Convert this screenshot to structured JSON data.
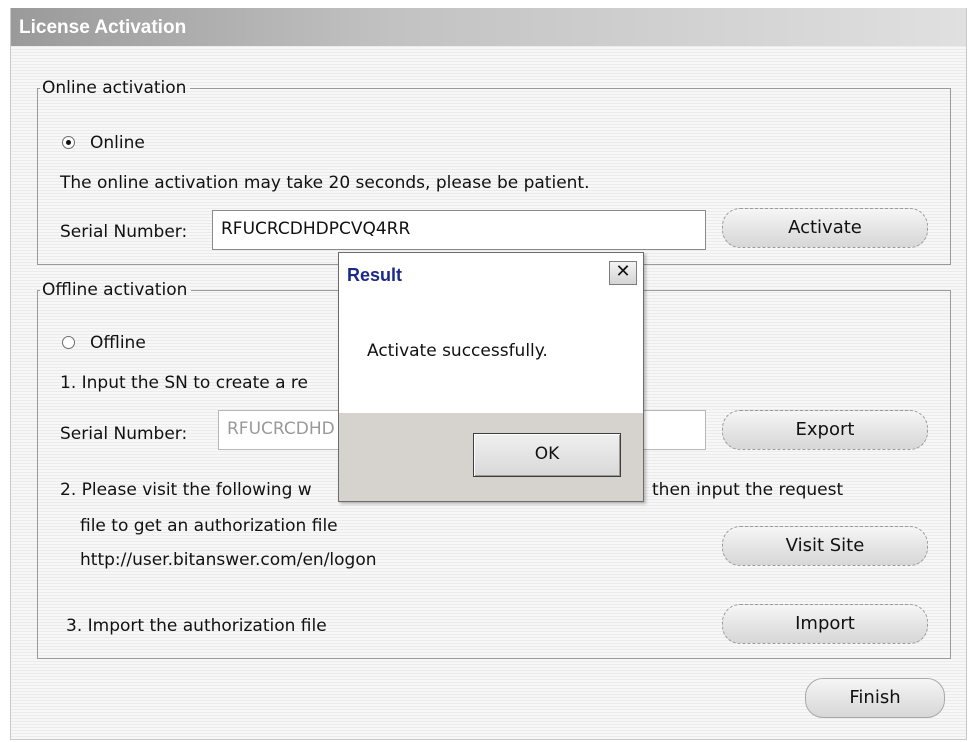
{
  "window": {
    "title": "License Activation"
  },
  "online": {
    "legend": "Online activation",
    "radio_label": "Online",
    "note": "The online activation may take 20 seconds, please be patient.",
    "serial_label": "Serial Number:",
    "serial_value": "RFUCRCDHDPCVQ4RR",
    "activate_label": "Activate"
  },
  "offline": {
    "legend": "Offline activation",
    "radio_label": "Offline",
    "step1": "1. Input the SN to create a re",
    "serial_label": "Serial Number:",
    "serial_value": "RFUCRCDHD",
    "export_label": "Export",
    "step2_line1_left": "2. Please visit the following w",
    "step2_line1_right": "then input the request",
    "step2_line2": "file to get an authorization file",
    "step2_url": "http://user.bitanswer.com/en/logon",
    "visit_label": "Visit Site",
    "step3": "3. Import the authorization file",
    "import_label": "Import"
  },
  "finish_label": "Finish",
  "dialog": {
    "title": "Result",
    "close_glyph": "✕",
    "message": "Activate successfully.",
    "ok_label": "OK"
  }
}
